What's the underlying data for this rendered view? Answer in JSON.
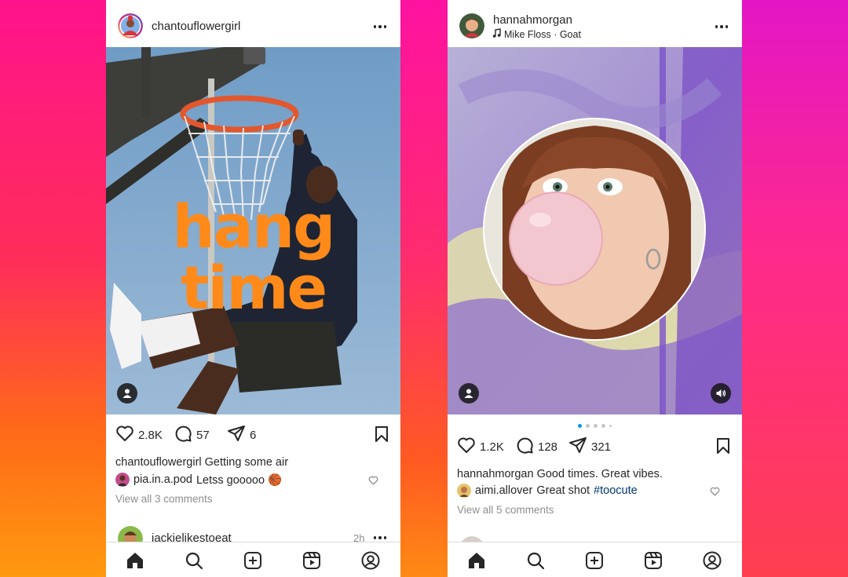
{
  "colors": {
    "background_top": "#ff1f8e",
    "background_bottom": "#ff8a14",
    "text_primary": "#262626",
    "text_secondary": "#8e8e8e",
    "hashtag": "#00376b",
    "carousel_active": "#0095f6",
    "headline_orange": "#ff8a1a"
  },
  "left_post": {
    "username": "chantouflowergirl",
    "media_overlay_line1": "hang",
    "media_overlay_line2": "time",
    "likes": "2.8K",
    "comments": "57",
    "shares": "6",
    "caption_user": "chantouflowergirl",
    "caption_text": "Getting some air",
    "top_comment_user": "pia.in.a.pod",
    "top_comment_text": "Letss gooooo 🏀",
    "view_all": "View all 3 comments",
    "next_post_user": "jackielikestoeat",
    "next_post_time": "2h",
    "icons": [
      "more-icon",
      "person-tag-icon",
      "heart-icon",
      "comment-icon",
      "share-icon",
      "bookmark-icon"
    ]
  },
  "right_post": {
    "username": "hannahmorgan",
    "music": "Mike Floss · Goat",
    "likes": "1.2K",
    "comments": "128",
    "shares": "321",
    "caption_user": "hannahmorgan",
    "caption_text": "Good times. Great vibes.",
    "top_comment_user": "aimi.allover",
    "top_comment_text": "Great shot",
    "top_comment_hashtag": "#toocute",
    "view_all": "View all 5 comments",
    "carousel_index": 1,
    "carousel_count": 5,
    "icons": [
      "music-note-icon",
      "more-icon",
      "person-tag-icon",
      "sound-icon",
      "heart-icon",
      "comment-icon",
      "share-icon",
      "bookmark-icon"
    ]
  },
  "tabbar": {
    "items": [
      "home-icon",
      "search-icon",
      "create-icon",
      "reels-icon",
      "profile-icon"
    ],
    "active": "home-icon"
  }
}
